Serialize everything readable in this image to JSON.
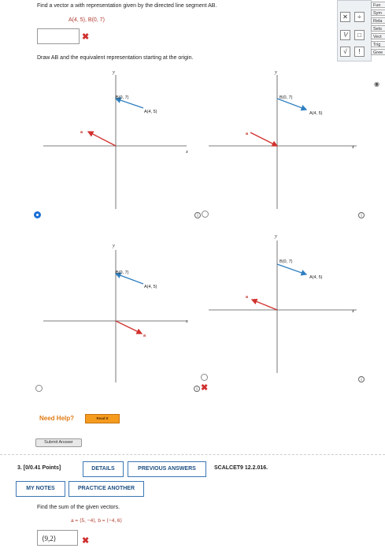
{
  "question2": {
    "prompt": "Find a vector a with representation given by the directed line segment AB.",
    "points": "A(4, 5),  B(0, 7)",
    "draw_instruction": "Draw AB and the equivalent representation starting at the origin."
  },
  "toolbar": {
    "row1": [
      "x",
      "+"
    ],
    "row2": [
      "□/□",
      "□□"
    ],
    "row3": [
      "√□",
      "□!"
    ]
  },
  "side_tabs": [
    "Fun",
    "Sym",
    "Rela",
    "Sets",
    "Vect",
    "Trig",
    "Gree"
  ],
  "graph_labels": {
    "y": "y",
    "x": "x",
    "a": "a",
    "B": "B(0, 7)",
    "A": "A(4, 5)"
  },
  "help": {
    "need_help": "Need Help?",
    "read_it": "Read It",
    "submit": "Submit Answer"
  },
  "question3": {
    "header": "3.  [0/0.41 Points]",
    "details": "DETAILS",
    "previous_answers": "PREVIOUS ANSWERS",
    "source": "SCALCET9 12.2.016.",
    "my_notes": "MY NOTES",
    "practice": "PRACTICE ANOTHER",
    "prompt": "Find the sum of the given vectors.",
    "vectors": "a = ⟨5, −4⟩,   b = ⟨−4, 6⟩",
    "answer_value": "⟨9,2⟩"
  },
  "colors": {
    "vector_blue": "#2f7fc1",
    "vector_red": "#d0312d",
    "radio_selected": "#1a6fd6"
  }
}
